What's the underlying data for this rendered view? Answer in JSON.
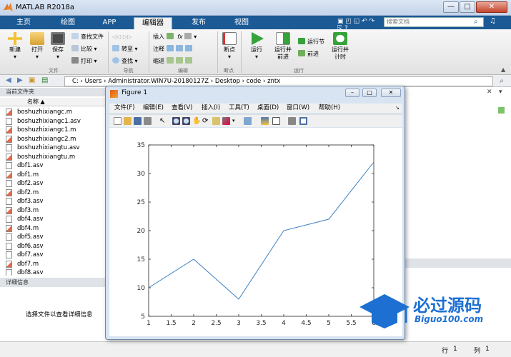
{
  "window": {
    "title": "MATLAB R2018a"
  },
  "tabs": [
    {
      "label": "主页",
      "active": false
    },
    {
      "label": "绘图",
      "active": false
    },
    {
      "label": "APP",
      "active": false
    },
    {
      "label": "编辑器",
      "active": true
    },
    {
      "label": "发布",
      "active": false
    },
    {
      "label": "视图",
      "active": false
    }
  ],
  "search": {
    "placeholder": "搜索文档"
  },
  "ribbon": {
    "new": "新建",
    "open": "打开",
    "save": "保存",
    "find_files": "查找文件",
    "compare": "比较",
    "print": "打印",
    "goto": "转至",
    "find": "查找",
    "insert": "插入",
    "fx": "fx",
    "comment": "注释",
    "indent": "缩进",
    "breakpoint": "断点",
    "run": "运行",
    "run_advance": "运行并\n前进",
    "run_section": "运行节",
    "advance": "前进",
    "run_time": "运行并\n计时",
    "groups": {
      "file": "文件",
      "nav": "导航",
      "edit": "编辑",
      "breakpoint": "断点",
      "run": "运行"
    }
  },
  "address": {
    "path": "C:  ›  Users  ›  Administrator.WIN7U-20180127Z  ›  Desktop  ›  code  ›  zntx"
  },
  "current_folder": {
    "title": "当前文件夹",
    "column_name": "名称 ▲",
    "files": [
      {
        "name": "boshuzhixiangc.m",
        "type": "m"
      },
      {
        "name": "boshuzhixiangc1.asv",
        "type": "asv"
      },
      {
        "name": "boshuzhixiangc1.m",
        "type": "m"
      },
      {
        "name": "boshuzhixiangc2.m",
        "type": "m"
      },
      {
        "name": "boshuzhixiangtu.asv",
        "type": "asv"
      },
      {
        "name": "boshuzhixiangtu.m",
        "type": "m"
      },
      {
        "name": "dbf1.asv",
        "type": "asv"
      },
      {
        "name": "dbf1.m",
        "type": "m"
      },
      {
        "name": "dbf2.asv",
        "type": "asv"
      },
      {
        "name": "dbf2.m",
        "type": "m"
      },
      {
        "name": "dbf3.asv",
        "type": "asv"
      },
      {
        "name": "dbf3.m",
        "type": "m"
      },
      {
        "name": "dbf4.asv",
        "type": "asv"
      },
      {
        "name": "dbf4.m",
        "type": "m"
      },
      {
        "name": "dbf5.asv",
        "type": "asv"
      },
      {
        "name": "dbf6.asv",
        "type": "asv"
      },
      {
        "name": "dbf7.asv",
        "type": "asv"
      },
      {
        "name": "dbf7.m",
        "type": "m"
      },
      {
        "name": "dbf8.asv",
        "type": "asv"
      }
    ]
  },
  "details": {
    "title": "详细信息",
    "message": "选择文件以查看详细信息"
  },
  "status": {
    "row_label": "行",
    "row": "1",
    "col_label": "列",
    "col": "1"
  },
  "figure": {
    "title": "Figure 1",
    "menu": [
      "文件(F)",
      "编辑(E)",
      "查看(V)",
      "插入(I)",
      "工具(T)",
      "桌面(D)",
      "窗口(W)",
      "帮助(H)"
    ]
  },
  "chart_data": {
    "type": "line",
    "x": [
      1,
      2,
      3,
      4,
      5,
      6
    ],
    "y": [
      10,
      15,
      8,
      20,
      22,
      32
    ],
    "xlim": [
      1,
      6
    ],
    "ylim": [
      5,
      35
    ],
    "xticks": [
      "1",
      "1.5",
      "2",
      "2.5",
      "3",
      "3.5",
      "4",
      "4.5",
      "5",
      "5.5",
      "6"
    ],
    "yticks": [
      "5",
      "10",
      "15",
      "20",
      "25",
      "30",
      "35"
    ],
    "line_color": "#3d7fc1",
    "grid": false
  },
  "watermark": {
    "text": "必过源码",
    "subtext": "Biguo100.com"
  },
  "colors": {
    "tabbar": "#1b5a95",
    "accent": "#2f7ec6",
    "watermark_blue": "#1d6fd1"
  }
}
